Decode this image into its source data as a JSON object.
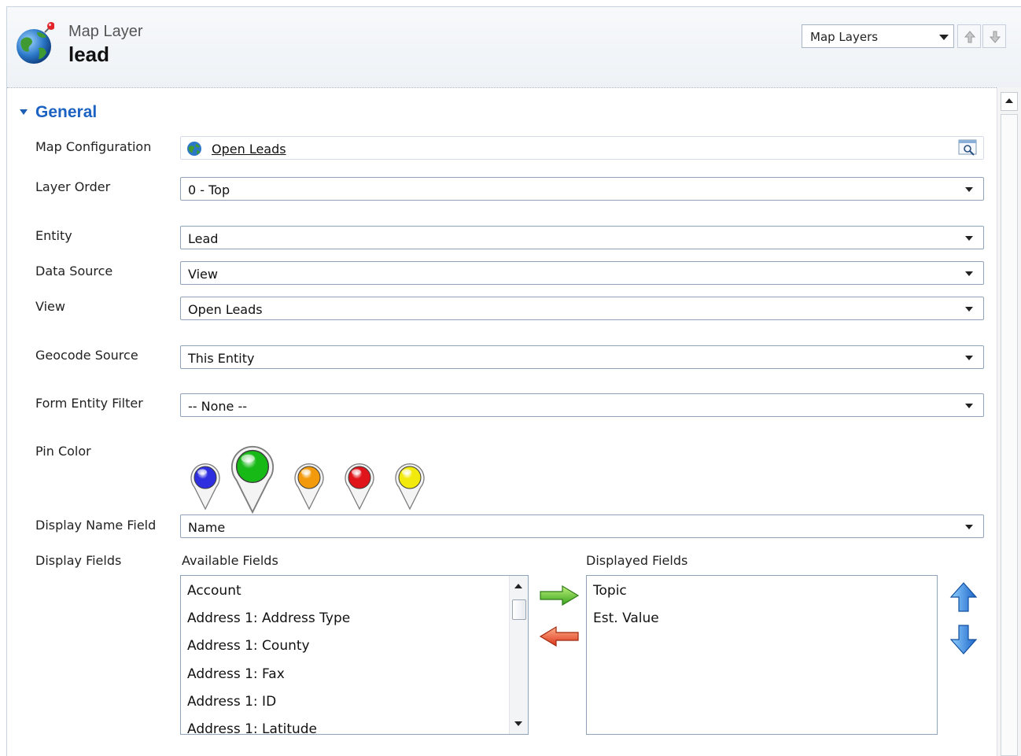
{
  "header": {
    "entity_type": "Map Layer",
    "record_name": "lead",
    "nav_select_value": "Map Layers"
  },
  "section": {
    "title": "General"
  },
  "form": {
    "map_configuration": {
      "label": "Map Configuration",
      "value": "Open Leads"
    },
    "layer_order": {
      "label": "Layer Order",
      "value": "0 - Top"
    },
    "entity": {
      "label": "Entity",
      "value": "Lead"
    },
    "data_source": {
      "label": "Data Source",
      "value": "View"
    },
    "view": {
      "label": "View",
      "value": "Open Leads"
    },
    "geocode_source": {
      "label": "Geocode Source",
      "value": "This Entity"
    },
    "form_entity_filter": {
      "label": "Form Entity Filter",
      "value": "-- None --"
    },
    "pin_color": {
      "label": "Pin Color",
      "options": [
        {
          "name": "blue",
          "color": "#2f2fe0"
        },
        {
          "name": "green",
          "color": "#17b917"
        },
        {
          "name": "orange",
          "color": "#f29a0c"
        },
        {
          "name": "red",
          "color": "#e0151b"
        },
        {
          "name": "yellow",
          "color": "#f2ea0c"
        }
      ],
      "selected": "green"
    },
    "display_name_field": {
      "label": "Display Name Field",
      "value": "Name"
    },
    "display_fields": {
      "label": "Display Fields",
      "available_label": "Available Fields",
      "displayed_label": "Displayed Fields",
      "available": [
        "Account",
        "Address 1: Address Type",
        "Address 1: County",
        "Address 1: Fax",
        "Address 1: ID",
        "Address 1: Latitude"
      ],
      "displayed": [
        "Topic",
        "Est. Value"
      ]
    }
  }
}
